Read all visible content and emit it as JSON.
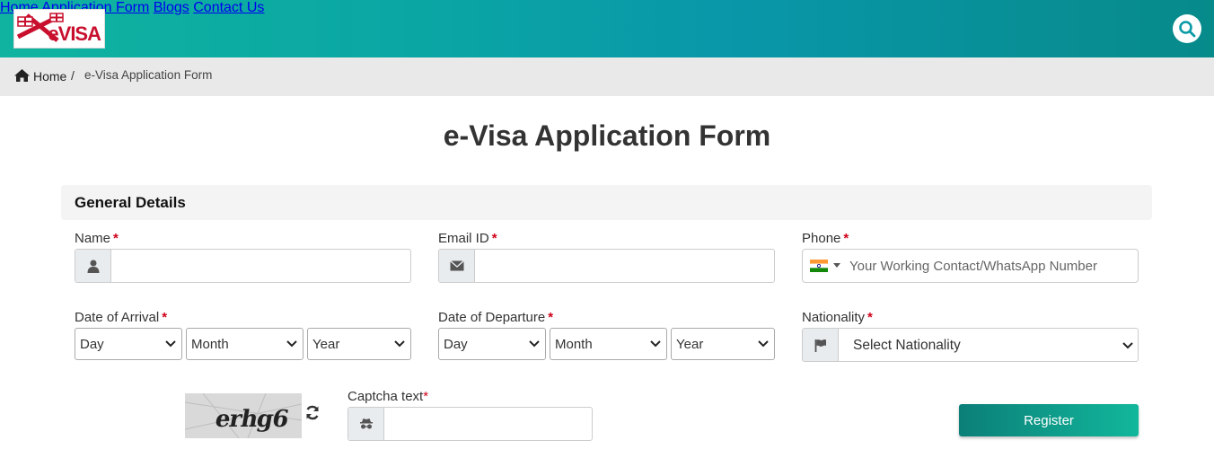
{
  "header": {
    "logo_text": "eVISA",
    "nav": [
      {
        "label": "Home"
      },
      {
        "label": "Application Form"
      },
      {
        "label": "Blogs"
      },
      {
        "label": "Contact Us"
      }
    ]
  },
  "breadcrumb": {
    "home": "Home",
    "separator": "/",
    "current": "e-Visa Application Form"
  },
  "page_title": "e-Visa Application Form",
  "section": {
    "title": "General Details"
  },
  "form": {
    "name_label": "Name",
    "email_label": "Email ID",
    "phone_label": "Phone",
    "phone_placeholder": "Your Working Contact/WhatsApp Number",
    "arrival_label": "Date of Arrival",
    "departure_label": "Date of Departure",
    "nationality_label": "Nationality",
    "required_mark": "*",
    "day": "Day",
    "month": "Month",
    "year": "Year",
    "nationality_selected": "Select Nationality",
    "captcha_label": "Captcha text",
    "captcha_image_text": "erhg6",
    "register_label": "Register"
  },
  "colors": {
    "header_start": "#10b3a0",
    "header_end": "#078a8a",
    "required": "#d0021b",
    "button_start": "#0b7f78",
    "button_end": "#12b79b"
  },
  "icons": {
    "breadcrumb": "home-icon",
    "name": "user-icon",
    "email": "envelope-icon",
    "phone": "india-flag-icon",
    "nationality": "flag-icon",
    "captcha_input": "incognito-icon",
    "captcha_refresh": "refresh-icon",
    "search": "search-icon"
  }
}
